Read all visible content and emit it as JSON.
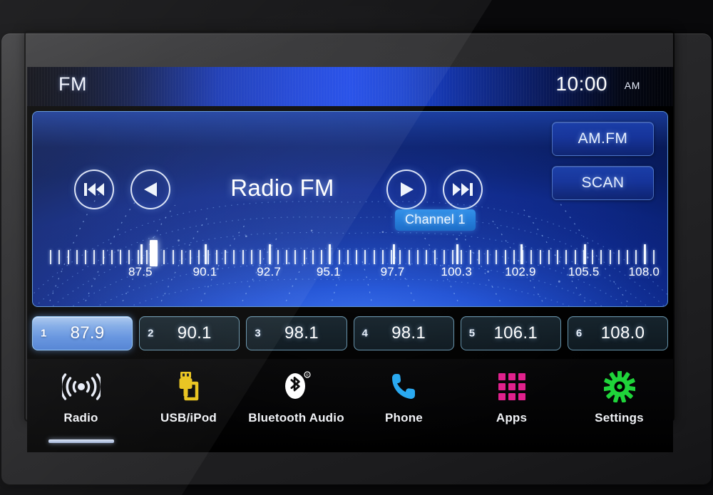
{
  "device": {
    "name": "car-head-unit"
  },
  "statusbar": {
    "source_label": "FM",
    "clock": "10:00",
    "meridiem": "AM"
  },
  "panel": {
    "title": "Radio FM",
    "channel_badge": "Channel 1",
    "buttons": {
      "prev": "skip-back-icon",
      "rewind": "rewind-icon",
      "play": "play-icon",
      "next": "skip-forward-icon"
    },
    "side_buttons": [
      {
        "label": "AM.FM",
        "name": "am-fm-button"
      },
      {
        "label": "SCAN",
        "name": "scan-button"
      }
    ],
    "tuner": {
      "current_frequency": "87.9",
      "cursor_percent": 16.5,
      "range_min": 87.5,
      "range_max": 108.0,
      "labels": [
        {
          "text": "87.5",
          "pos": 15.0
        },
        {
          "text": "90.1",
          "pos": 25.7
        },
        {
          "text": "92.7",
          "pos": 36.3
        },
        {
          "text": "95.1",
          "pos": 46.2
        },
        {
          "text": "97.7",
          "pos": 56.8
        },
        {
          "text": "100.3",
          "pos": 67.4
        },
        {
          "text": "102.9",
          "pos": 78.0
        },
        {
          "text": "105.5",
          "pos": 88.5
        },
        {
          "text": "108.0",
          "pos": 98.5
        }
      ]
    }
  },
  "presets": [
    {
      "number": "1",
      "frequency": "87.9",
      "active": true
    },
    {
      "number": "2",
      "frequency": "90.1",
      "active": false
    },
    {
      "number": "3",
      "frequency": "98.1",
      "active": false
    },
    {
      "number": "4",
      "frequency": "98.1",
      "active": false
    },
    {
      "number": "5",
      "frequency": "106.1",
      "active": false
    },
    {
      "number": "6",
      "frequency": "108.0",
      "active": false
    }
  ],
  "navbar": [
    {
      "label": "Radio",
      "icon": "broadcast-icon",
      "active": true,
      "color": "#e8ecf7"
    },
    {
      "label": "USB/iPod",
      "icon": "usb-plug-icon",
      "active": false,
      "color": "#e8c218"
    },
    {
      "label": "Bluetooth Audio",
      "icon": "bluetooth-icon",
      "active": false,
      "color": "#ffffff"
    },
    {
      "label": "Phone",
      "icon": "phone-icon",
      "active": false,
      "color": "#28a8f0"
    },
    {
      "label": "Apps",
      "icon": "apps-grid-icon",
      "active": false,
      "color": "#e0208c"
    },
    {
      "label": "Settings",
      "icon": "gear-icon",
      "active": false,
      "color": "#1fd43a"
    }
  ],
  "colors": {
    "accent_blue": "#1a46e8",
    "panel_border": "#5a92d8",
    "badge_blue": "#1f7ad8",
    "preset_active": "#5f90de",
    "bezel": "#242426"
  }
}
